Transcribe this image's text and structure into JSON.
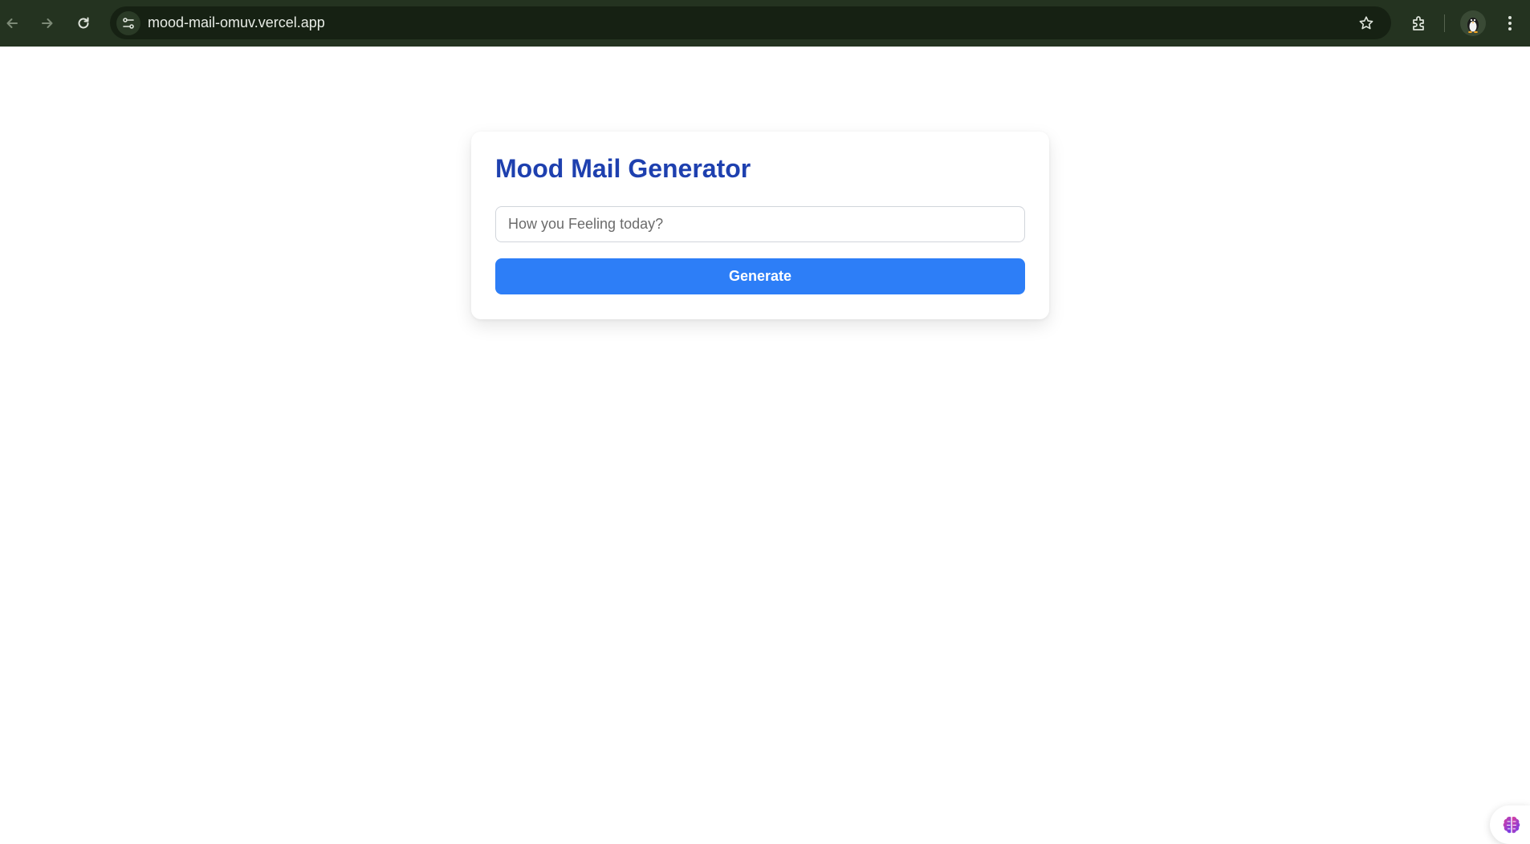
{
  "browser": {
    "url": "mood-mail-omuv.vercel.app",
    "chrome_color": "#243320",
    "omnibox_color": "#162113"
  },
  "card": {
    "title": "Mood Mail Generator",
    "title_color": "#1e40af",
    "input_placeholder": "How you Feeling today?",
    "input_value": "",
    "button_label": "Generate",
    "button_color": "#2d7ef7"
  },
  "widget": {
    "icon": "brain-icon"
  }
}
